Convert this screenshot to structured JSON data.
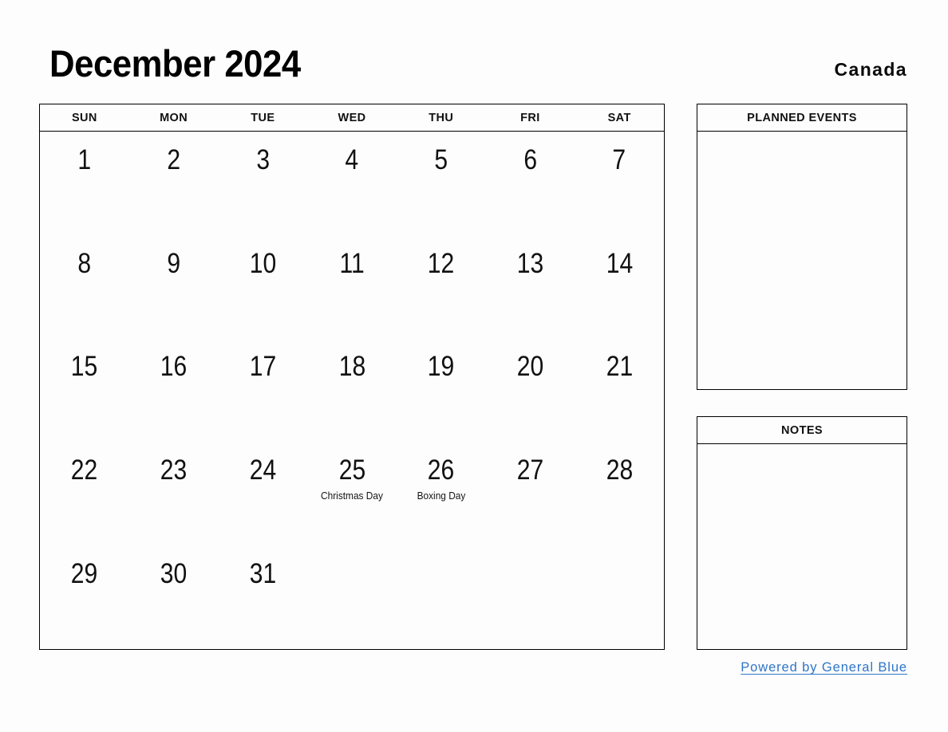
{
  "header": {
    "title": "December 2024",
    "country": "Canada"
  },
  "calendar": {
    "weekdays": [
      "SUN",
      "MON",
      "TUE",
      "WED",
      "THU",
      "FRI",
      "SAT"
    ],
    "weeks": [
      [
        {
          "day": "1"
        },
        {
          "day": "2"
        },
        {
          "day": "3"
        },
        {
          "day": "4"
        },
        {
          "day": "5"
        },
        {
          "day": "6"
        },
        {
          "day": "7"
        }
      ],
      [
        {
          "day": "8"
        },
        {
          "day": "9"
        },
        {
          "day": "10"
        },
        {
          "day": "11"
        },
        {
          "day": "12"
        },
        {
          "day": "13"
        },
        {
          "day": "14"
        }
      ],
      [
        {
          "day": "15"
        },
        {
          "day": "16"
        },
        {
          "day": "17"
        },
        {
          "day": "18"
        },
        {
          "day": "19"
        },
        {
          "day": "20"
        },
        {
          "day": "21"
        }
      ],
      [
        {
          "day": "22"
        },
        {
          "day": "23"
        },
        {
          "day": "24"
        },
        {
          "day": "25",
          "event": "Christmas Day"
        },
        {
          "day": "26",
          "event": "Boxing Day"
        },
        {
          "day": "27"
        },
        {
          "day": "28"
        }
      ],
      [
        {
          "day": "29"
        },
        {
          "day": "30"
        },
        {
          "day": "31"
        },
        {
          "day": ""
        },
        {
          "day": ""
        },
        {
          "day": ""
        },
        {
          "day": ""
        }
      ]
    ]
  },
  "sidebar": {
    "planned_events": {
      "title": "PLANNED EVENTS",
      "content": ""
    },
    "notes": {
      "title": "NOTES",
      "content": ""
    }
  },
  "footer": {
    "link_label": "Powered by General Blue",
    "link_color": "#2e75c8"
  }
}
